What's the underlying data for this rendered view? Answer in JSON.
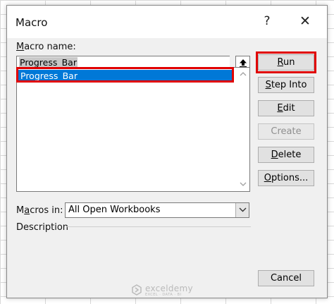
{
  "dialog": {
    "title": "Macro",
    "help_glyph": "?",
    "close_glyph": "✕"
  },
  "macro_name": {
    "label_accel": "M",
    "label_rest": "acro name:",
    "value": "Progress_Bar",
    "up_icon": "upload-arrow-icon"
  },
  "macro_list": {
    "items": [
      "Progress_Bar"
    ],
    "selected_index": 0
  },
  "buttons": {
    "run": {
      "accel": "R",
      "rest": "un"
    },
    "step_into": {
      "accel": "S",
      "rest": "tep Into"
    },
    "edit": {
      "accel": "E",
      "rest": "dit"
    },
    "create": {
      "label": "Create"
    },
    "delete": {
      "accel": "D",
      "rest": "elete"
    },
    "options": {
      "accel": "O",
      "rest": "ptions..."
    },
    "cancel": {
      "label": "Cancel"
    }
  },
  "macros_in": {
    "label_pre": "M",
    "label_accel": "a",
    "label_rest": "cros in:",
    "selected": "All Open Workbooks"
  },
  "description": {
    "label": "Description"
  },
  "watermark": {
    "main": "exceldemy",
    "sub": "EXCEL · DATA · BI"
  },
  "highlight_color": "#e00000",
  "selection_color": "#0078d7"
}
